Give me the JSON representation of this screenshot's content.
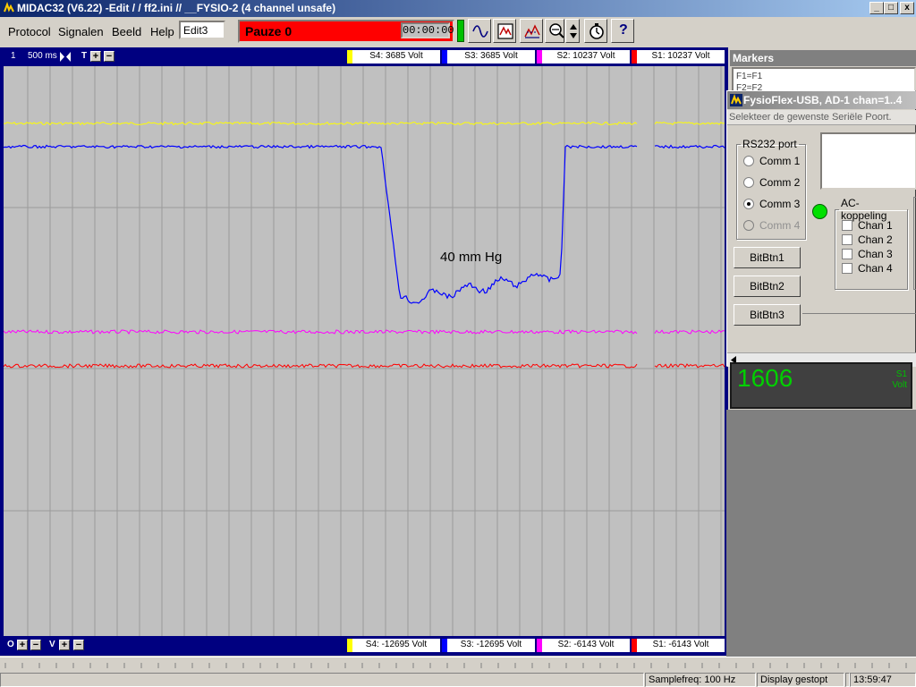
{
  "window": {
    "title": "MIDAC32  (V6.22)  -Edit /  / ff2.ini //  __FYSIO-2 (4 channel unsafe)",
    "controls": [
      "_",
      "□",
      "x"
    ]
  },
  "menu": {
    "items": [
      {
        "label": "Protocol"
      },
      {
        "label": "Signalen"
      },
      {
        "label": "Beeld"
      },
      {
        "label": "Help"
      }
    ],
    "edit_value": "Edit3"
  },
  "toolbar": {
    "pause_label": "Pauze 0",
    "timer": "00:00:00",
    "buttons": [
      "waveform-icon",
      "screenshot-icon",
      "analysis-icon",
      "zoom-icon",
      "updown-icon",
      "stopwatch-icon",
      "help-icon"
    ],
    "help_label": "?"
  },
  "scope": {
    "top": {
      "page_number": "1",
      "timebase": "500 ms",
      "time_label": "T",
      "plus": "+",
      "minus": "−",
      "channels": [
        {
          "label": "S4: 3685 Volt",
          "color": "#ffff00"
        },
        {
          "label": "S3: 3685 Volt",
          "color": "#0000ff"
        },
        {
          "label": "S2: 10237 Volt",
          "color": "#ff00ff"
        },
        {
          "label": "S1: 10237 Volt",
          "color": "#ff0000"
        }
      ]
    },
    "bottom": {
      "offset_label": "O",
      "volt_label": "V",
      "plus": "+",
      "minus": "−",
      "channels": [
        {
          "label": "S4: -12695 Volt",
          "color": "#ffff00"
        },
        {
          "label": "S3: -12695 Volt",
          "color": "#0000ff"
        },
        {
          "label": "S2: -6143 Volt",
          "color": "#ff00ff"
        },
        {
          "label": "S1: -6143 Volt",
          "color": "#ff0000"
        }
      ]
    },
    "annotation": "40 mm Hg",
    "trace_colors": {
      "s4": "#ffff00",
      "s3": "#0000ff",
      "s2": "#ff00ff",
      "s1": "#ff0000"
    }
  },
  "markers": {
    "title": "Markers",
    "items": [
      "F1=F1",
      "F2=F2"
    ]
  },
  "fysio": {
    "title": "FysioFlex-USB, AD-1 chan=1..4",
    "hint": "Selekteer de gewenste Seriële Poort.",
    "rs232": {
      "legend": "RS232 port",
      "ports": [
        {
          "label": "Comm 1",
          "checked": false,
          "enabled": true
        },
        {
          "label": "Comm 2",
          "checked": false,
          "enabled": true
        },
        {
          "label": "Comm 3",
          "checked": true,
          "enabled": true
        },
        {
          "label": "Comm 4",
          "checked": false,
          "enabled": false
        }
      ]
    },
    "ac": {
      "legend": "AC-koppeling",
      "channels": [
        {
          "label": "Chan 1",
          "checked": false
        },
        {
          "label": "Chan 2",
          "checked": false
        },
        {
          "label": "Chan 3",
          "checked": false
        },
        {
          "label": "Chan 4",
          "checked": false
        }
      ]
    },
    "buttons": [
      "BitBtn1",
      "BitBtn2",
      "BitBtn3"
    ],
    "led_color": "#00e000"
  },
  "readout": {
    "value": "1606",
    "channel": "S1",
    "unit": "Volt"
  },
  "status": {
    "panes": [
      "",
      "Samplefreq: 100 Hz",
      "Display gestopt",
      "",
      "13:59:47"
    ]
  }
}
